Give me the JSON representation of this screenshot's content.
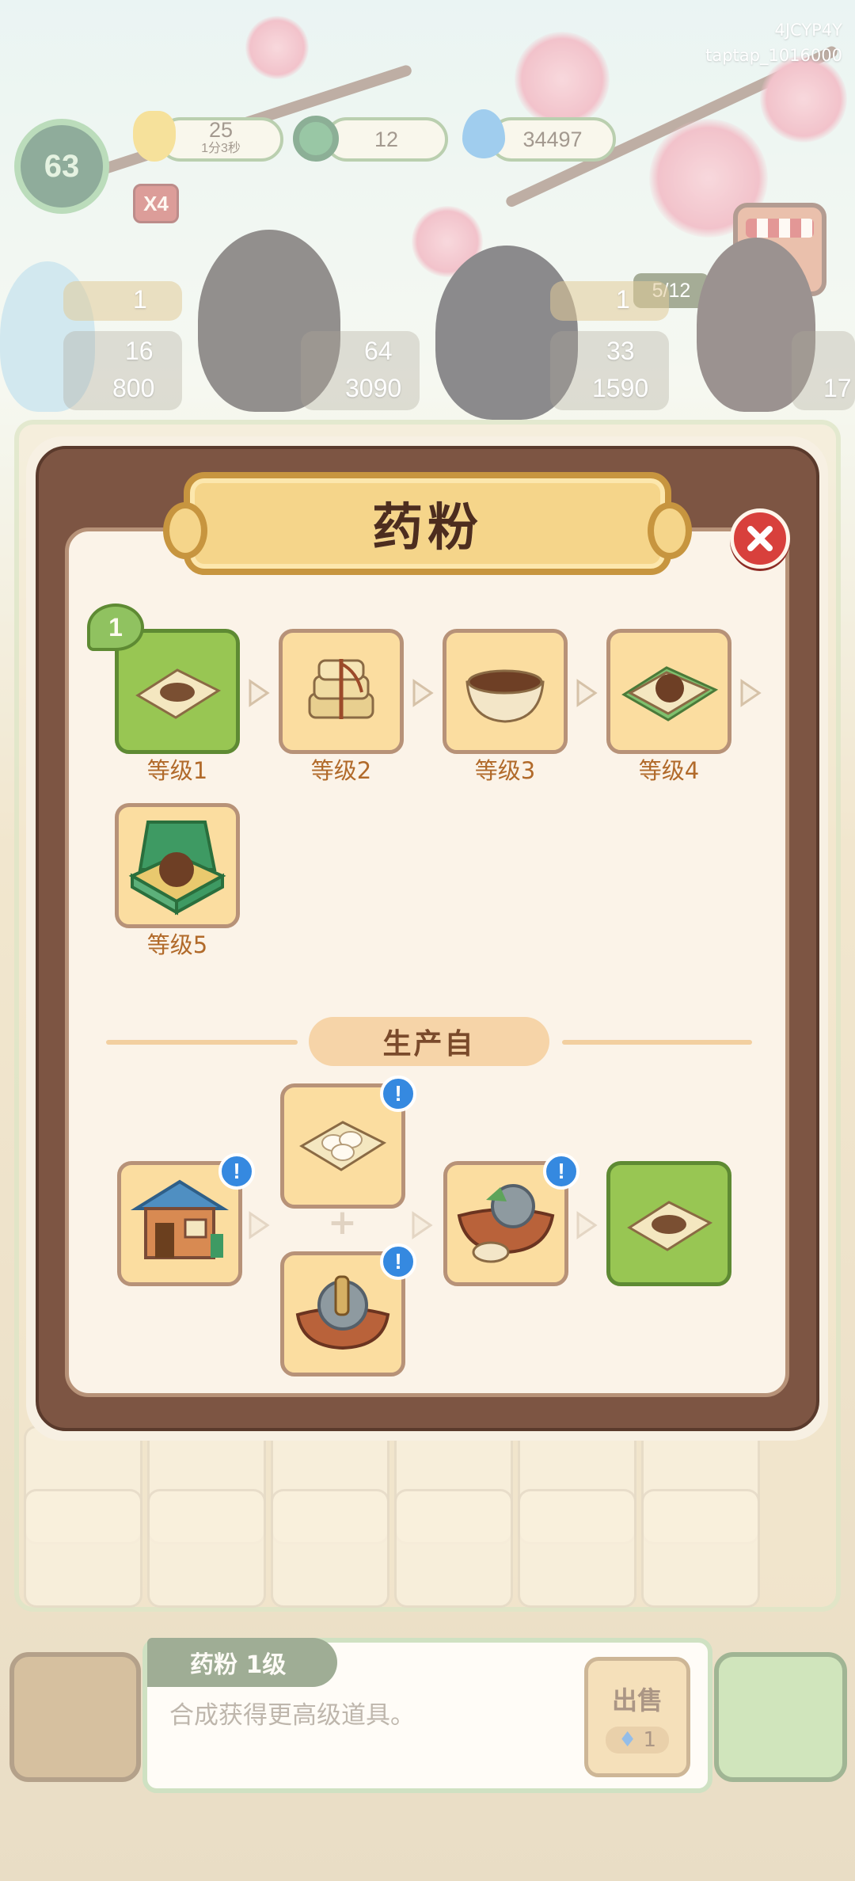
{
  "account": {
    "code": "4JCYP4Y",
    "user": "taptap_1016000"
  },
  "hud": {
    "level": "63",
    "energy": "25",
    "energy_timer": "1分3秒",
    "jade": "12",
    "spirit": "34497",
    "multiplier": "X4",
    "order_progress": "5/12"
  },
  "customers": [
    {
      "flowers": "1",
      "coins": "16",
      "spirit": "800"
    },
    {
      "coins": "64",
      "spirit": "3090"
    },
    {
      "flowers": "1",
      "coins": "33",
      "spirit": "1590"
    },
    {
      "spirit": "17"
    }
  ],
  "modal": {
    "title": "药粉",
    "close_icon": "close-icon",
    "current_level": "1",
    "chain": [
      {
        "label": "等级1",
        "icon": "powder-paper-icon"
      },
      {
        "label": "等级2",
        "icon": "tied-herb-bundle-icon"
      },
      {
        "label": "等级3",
        "icon": "powder-bowl-icon"
      },
      {
        "label": "等级4",
        "icon": "herb-pill-leaf-icon"
      },
      {
        "label": "等级5",
        "icon": "jade-box-pill-icon"
      }
    ],
    "section_title": "生产自",
    "production": {
      "source": "pharmacy-building-icon",
      "ingredient_a": "white-seeds-paper-icon",
      "ingredient_b": "grinding-wheel-icon",
      "tool": "herb-grinder-icon",
      "result": "powder-paper-icon",
      "info_mark": "!"
    }
  },
  "selected_item": {
    "name": "药粉 1级",
    "description": "合成获得更高级道具。",
    "sell_label": "出售",
    "sell_price": "1"
  },
  "colors": {
    "wood": "#7d5543",
    "current_tile": "#98c653",
    "tile": "#fbdda0",
    "label": "#b16a2a",
    "info_badge": "#3589e0"
  }
}
